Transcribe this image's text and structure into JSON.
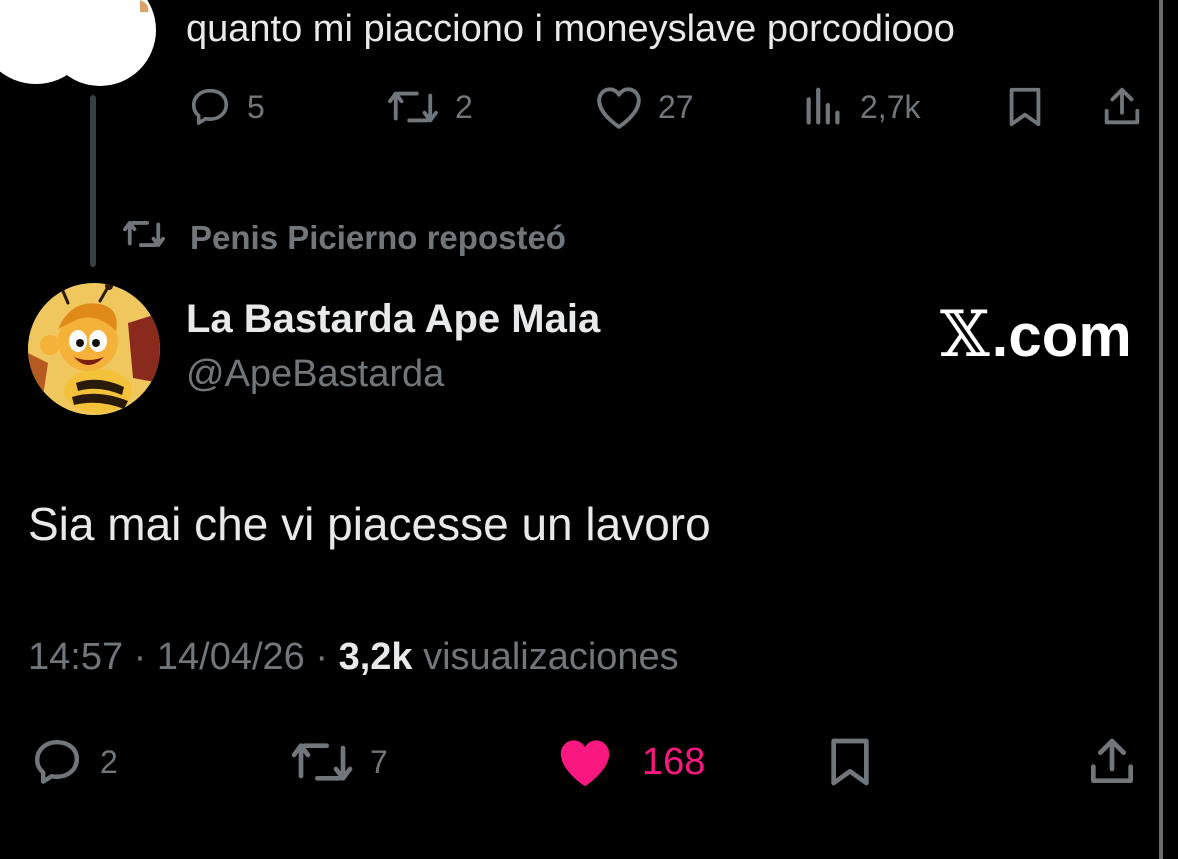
{
  "previous_tweet": {
    "text": "quanto mi piacciono i moneyslave porcodiooo",
    "actions": {
      "replies": "5",
      "reposts": "2",
      "likes": "27",
      "views": "2,7k"
    }
  },
  "repost_banner": {
    "label": "Penis Picierno reposteó"
  },
  "tweet": {
    "display_name": "La Bastarda Ape Maia",
    "handle": "@ApeBastarda",
    "text": "Sia mai che vi piacesse un lavoro",
    "time": "14:57",
    "date": "14/04/26",
    "views_count": "3,2k",
    "views_label": "visualizaciones",
    "separator": "·",
    "actions": {
      "replies": "2",
      "reposts": "7",
      "likes": "168"
    }
  },
  "watermark": {
    "logo": "𝕏",
    "domain": ".com"
  },
  "icons": {
    "reply": "reply-icon",
    "repost": "repost-icon",
    "like": "heart-icon",
    "views": "views-icon",
    "bookmark": "bookmark-icon",
    "share": "share-icon"
  },
  "colors": {
    "background": "#000000",
    "text": "#e7e9ea",
    "muted": "#71767b",
    "like_active": "#f91880"
  }
}
